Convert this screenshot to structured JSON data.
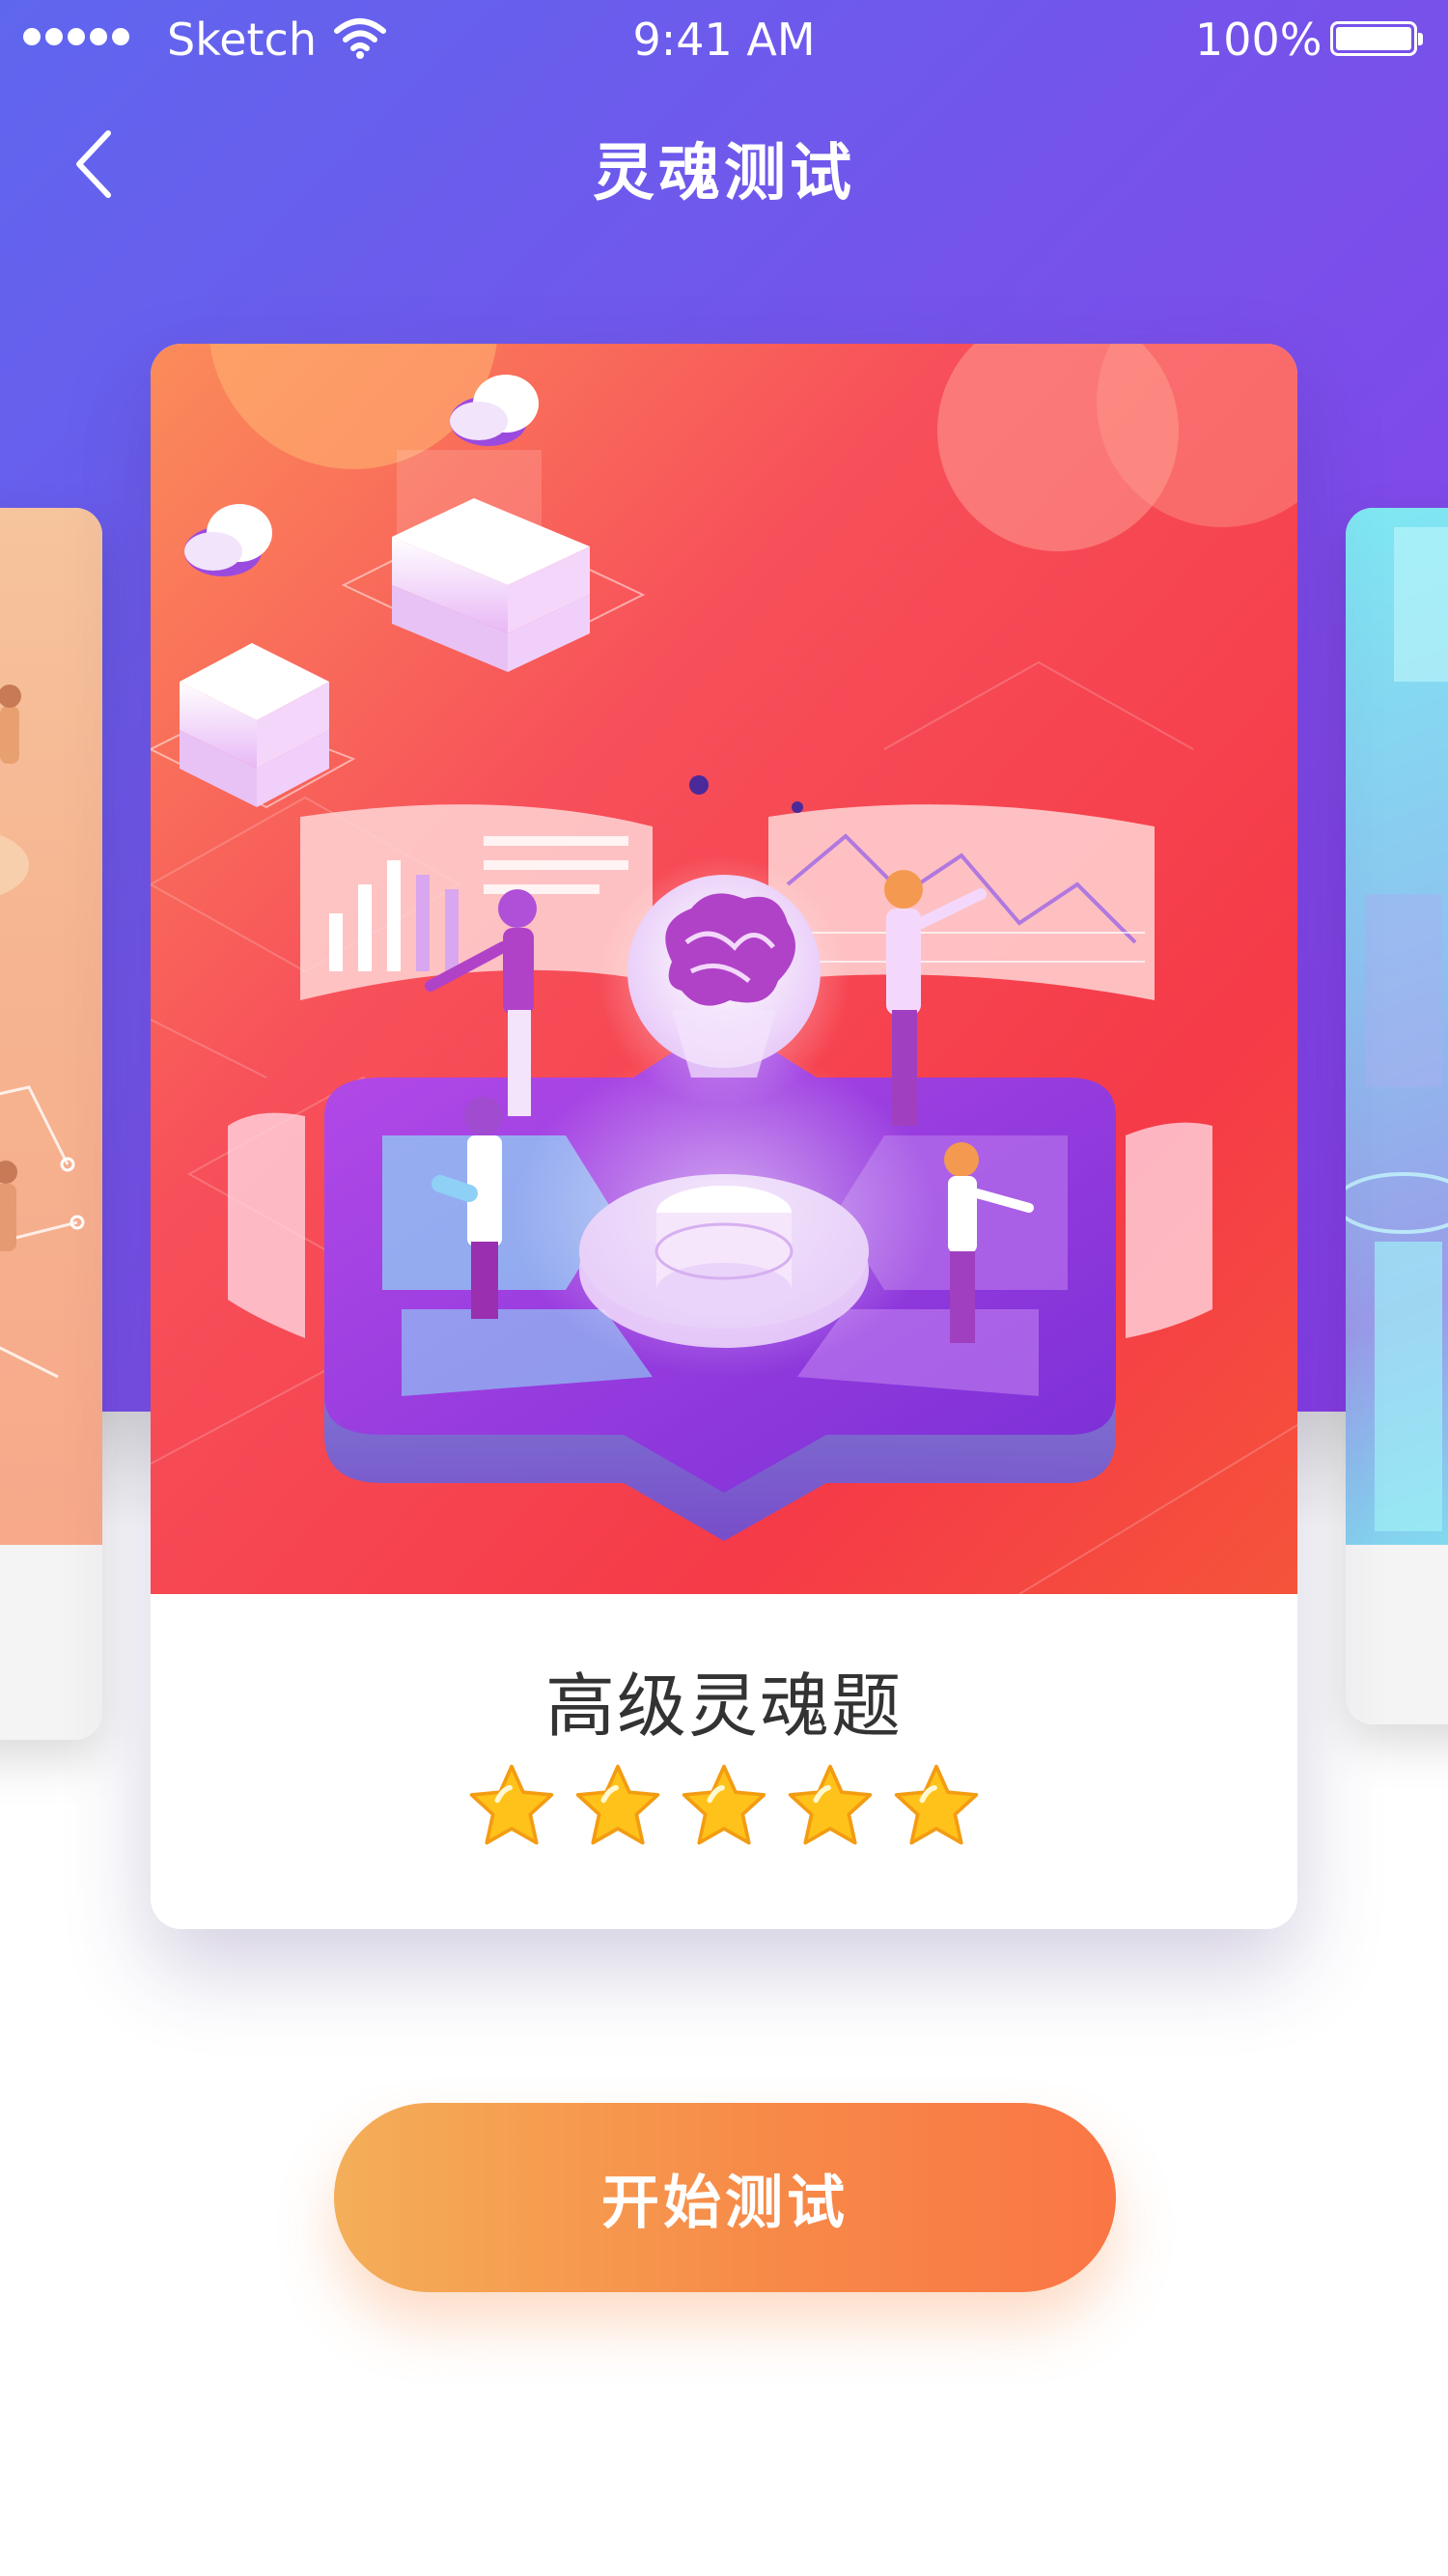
{
  "status_bar": {
    "carrier": "Sketch",
    "time": "9:41 AM",
    "battery": "100%"
  },
  "nav": {
    "title": "灵魂测试",
    "back_icon": "chevron-left-icon"
  },
  "carousel": {
    "active_card": {
      "title": "高级灵魂题",
      "rating": 5,
      "rating_max": 5,
      "illustration": "isometric brain and data platform illustration"
    }
  },
  "actions": {
    "start_label": "开始测试"
  },
  "colors": {
    "header_start": "#5f66ee",
    "header_end": "#8a3ce8",
    "card_art_top": "#fb8c5a",
    "card_art_main": "#f53a4a",
    "button_start": "#f4ae58",
    "button_end": "#fa7645",
    "star": "#ffc21a"
  }
}
